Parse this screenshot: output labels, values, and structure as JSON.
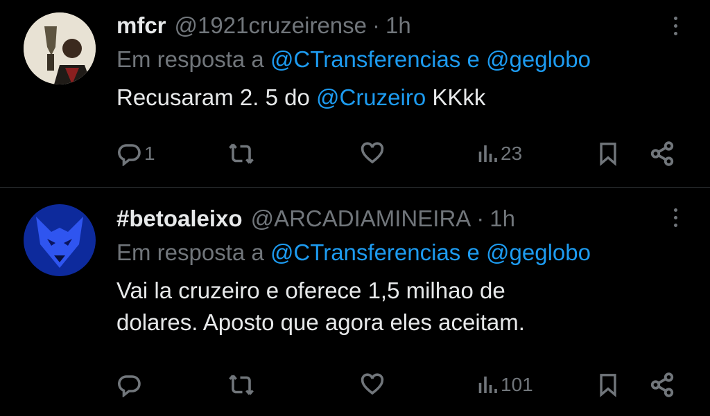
{
  "tweets": [
    {
      "display_name": "mfcr",
      "handle": "@1921cruzeirense",
      "separator": "·",
      "time": "1h",
      "reply_prefix": "Em resposta a",
      "reply_user1": "@CTransferencias",
      "reply_conj": "e",
      "reply_user2": "@geglobo",
      "text_part1": "Recusaram 2. 5 do ",
      "text_mention": "@Cruzeiro",
      "text_part2": " KKkk",
      "replies": "1",
      "retweets": "",
      "likes": "",
      "views": "23",
      "avatar_colors": [
        "#d9d2c3",
        "#6f6550",
        "#2b241c"
      ]
    },
    {
      "display_name": "#betoaleixo",
      "handle": "@ARCADIAMINEIRA",
      "separator": "·",
      "time": "1h",
      "reply_prefix": "Em resposta a",
      "reply_user1": "@CTransferencias",
      "reply_conj": "e",
      "reply_user2": "@geglobo",
      "text_line1": "Vai la cruzeiro e oferece 1,5 milhao de",
      "text_line2": "dolares. Aposto que agora eles aceitam.",
      "replies": "",
      "retweets": "",
      "likes": "",
      "views": "101",
      "avatar_colors": [
        "#0a1a6e",
        "#2b4de8",
        "#071040"
      ]
    }
  ],
  "colors": {
    "background": "#000000",
    "text": "#e7e9ea",
    "secondary": "#71767b",
    "link": "#1d9bf0",
    "divider": "#2f3336"
  }
}
